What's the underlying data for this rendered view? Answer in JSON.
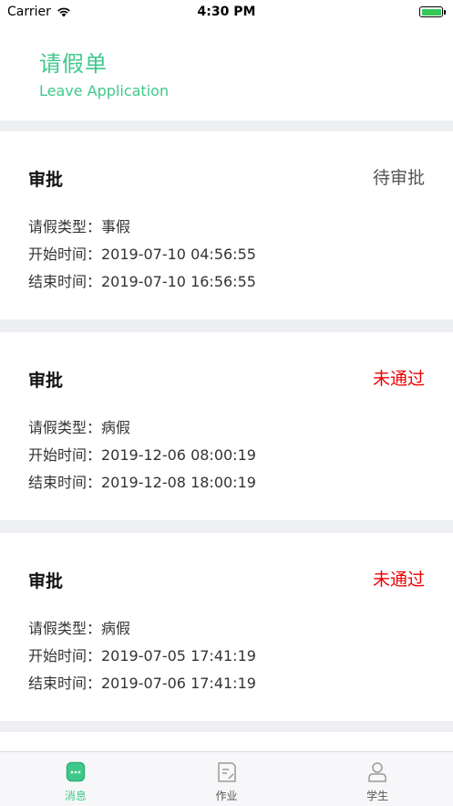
{
  "status_bar": {
    "carrier": "Carrier",
    "time": "4:30 PM"
  },
  "header": {
    "title": "请假单",
    "subtitle": "Leave Application"
  },
  "colors": {
    "accent": "#3ec98b",
    "pending": "#555555",
    "rejected": "#ee0000"
  },
  "cards": [
    {
      "title": "审批",
      "status": "待审批",
      "status_type": "pending",
      "type_line": "请假类型：事假",
      "start_line": "开始时间：2019-07-10 04:56:55",
      "end_line": "结束时间：2019-07-10 16:56:55"
    },
    {
      "title": "审批",
      "status": "未通过",
      "status_type": "rejected",
      "type_line": "请假类型：病假",
      "start_line": "开始时间：2019-12-06 08:00:19",
      "end_line": "结束时间：2019-12-08 18:00:19"
    },
    {
      "title": "审批",
      "status": "未通过",
      "status_type": "rejected",
      "type_line": "请假类型：病假",
      "start_line": "开始时间：2019-07-05 17:41:19",
      "end_line": "结束时间：2019-07-06 17:41:19"
    }
  ],
  "tabbar": {
    "tabs": [
      {
        "label": "消息",
        "icon": "message-icon",
        "active": true
      },
      {
        "label": "作业",
        "icon": "homework-icon",
        "active": false
      },
      {
        "label": "学生",
        "icon": "student-icon",
        "active": false
      }
    ]
  }
}
